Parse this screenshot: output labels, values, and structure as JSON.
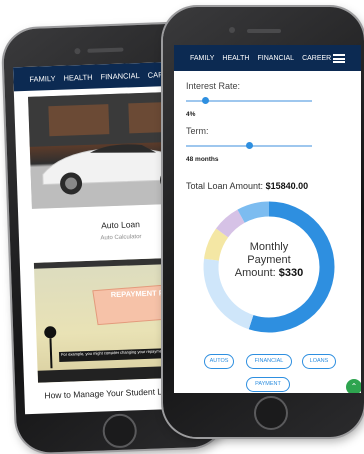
{
  "nav": {
    "items": [
      "FAMILY",
      "HEALTH",
      "FINANCIAL",
      "CAREER"
    ]
  },
  "back_screen": {
    "cards": [
      {
        "title": "Auto Loan",
        "subtitle": "Auto Calculator"
      },
      {
        "video_banner": "REPAYMENT PLAN",
        "caption": "For example, you might consider changing your repayment",
        "title": "How to Manage Your Student L"
      }
    ]
  },
  "calculator": {
    "interest_rate": {
      "label": "Interest Rate:",
      "value": "4%",
      "level": 0.15
    },
    "term": {
      "label": "Term:",
      "value": "48 months",
      "level": 0.5
    },
    "total_label": "Total Loan Amount:",
    "total_value": "$15840.00",
    "donut": {
      "line1": "Monthly",
      "line2": "Payment",
      "line3": "Amount:",
      "amount": "$330"
    },
    "segments": [
      {
        "name": "principal",
        "fraction": 0.55,
        "color": "#2e8fe0"
      },
      {
        "name": "secondary",
        "fraction": 0.22,
        "color": "#cfe6fa"
      },
      {
        "name": "yellow",
        "fraction": 0.08,
        "color": "#f4e7a4"
      },
      {
        "name": "purple",
        "fraction": 0.07,
        "color": "#d6c2e6"
      },
      {
        "name": "light-blue",
        "fraction": 0.08,
        "color": "#7cbcf0"
      }
    ]
  },
  "tags": [
    "AUTOS",
    "FINANCIAL",
    "LOANS",
    "PAYMENT"
  ],
  "colors": {
    "nav": "#0c2a52",
    "accent": "#2e8fe0",
    "fab": "#2ea44f"
  }
}
